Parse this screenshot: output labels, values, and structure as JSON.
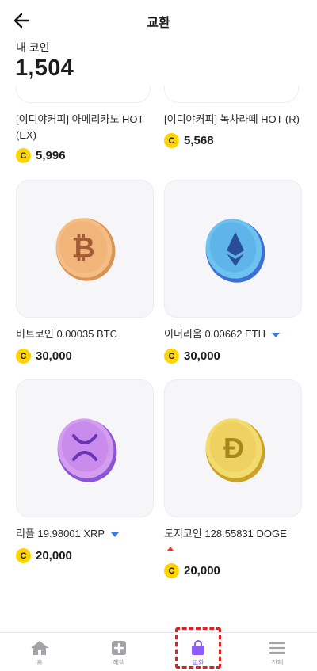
{
  "header": {
    "title": "교환"
  },
  "balance": {
    "label": "내 코인",
    "value": "1,504"
  },
  "coin_symbol": "C",
  "items": [
    {
      "name": "[이디야커피] 아메리카노 HOT (EX)",
      "price": "5,996"
    },
    {
      "name": "[이디야커피] 녹차라떼 HOT (R)",
      "price": "5,568"
    },
    {
      "name": "비트코인 0.00035 BTC",
      "price": "30,000"
    },
    {
      "name": "이더리움 0.00662 ETH",
      "price": "30,000"
    },
    {
      "name": "리플 19.98001 XRP",
      "price": "20,000"
    },
    {
      "name": "도지코인 128.55831 DOGE",
      "price": "20,000"
    }
  ],
  "tabs": [
    {
      "label": "홈",
      "icon": "home-icon"
    },
    {
      "label": "혜택",
      "icon": "plus-square-icon"
    },
    {
      "label": "교환",
      "icon": "shopping-bag-icon"
    },
    {
      "label": "전체",
      "icon": "menu-icon"
    }
  ],
  "colors": {
    "accent": "#8e5cf7",
    "coin": "#ffd400",
    "highlight": "#e32020"
  }
}
